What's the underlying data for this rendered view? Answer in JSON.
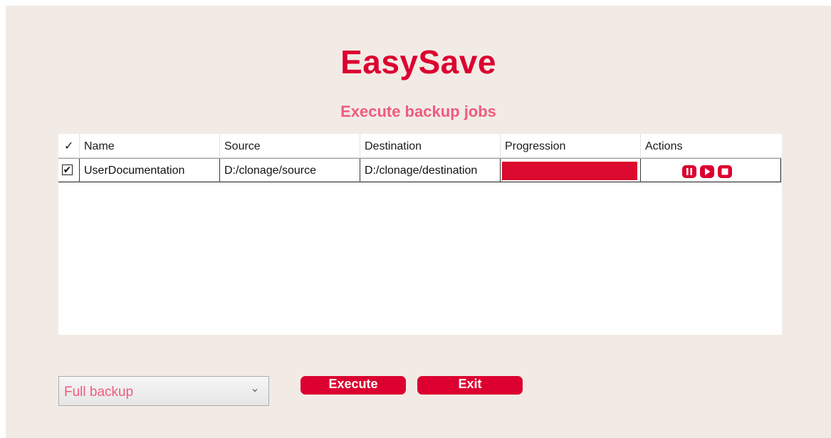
{
  "app": {
    "title": "EasySave",
    "subtitle": "Execute backup jobs"
  },
  "grid": {
    "columns": [
      "✓",
      "Name",
      "Source",
      "Destination",
      "Progression",
      "Actions"
    ],
    "rows": [
      {
        "selected": true,
        "checkbox_glyph": "✔",
        "name": "UserDocumentation",
        "source": "D:/clonage/source",
        "destination": "D:/clonage/destination",
        "progress": 1.0,
        "actions": [
          "pause-icon",
          "play-icon",
          "stop-icon"
        ]
      }
    ]
  },
  "controls": {
    "backup_type": {
      "selected": "Full backup"
    },
    "execute_label": "Execute",
    "exit_label": "Exit"
  },
  "colors": {
    "accent": "#dc0030",
    "subtitle": "#ef5b7e",
    "background": "#f2ebe5"
  }
}
